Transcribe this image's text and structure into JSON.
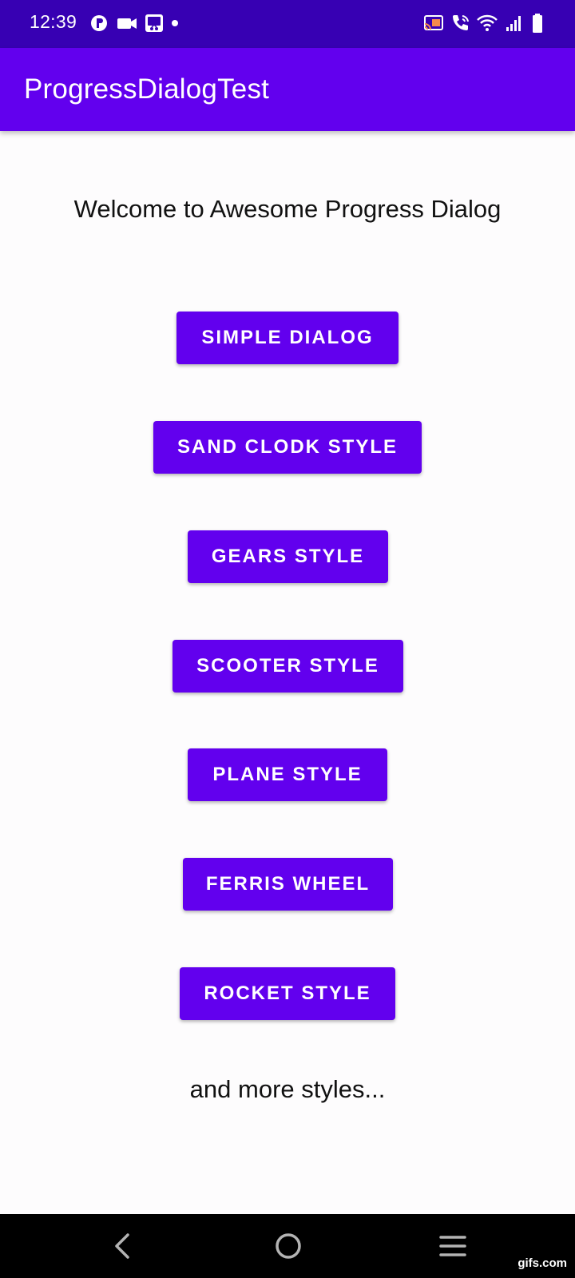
{
  "status_bar": {
    "time": "12:39",
    "left_icons": [
      "app-notification-icon",
      "video-camera-icon",
      "screen-record-icon",
      "dot-icon"
    ],
    "right_icons": [
      "cast-icon",
      "wifi-calling-icon",
      "wifi-icon",
      "cellular-signal-icon",
      "battery-icon"
    ],
    "color": "#3700b3"
  },
  "app_bar": {
    "title": "ProgressDialogTest",
    "color": "#6200ee"
  },
  "main": {
    "welcome_text": "Welcome to Awesome Progress Dialog",
    "buttons": [
      {
        "label": "SIMPLE DIALOG"
      },
      {
        "label": "SAND CLODK STYLE"
      },
      {
        "label": "GEARS STYLE"
      },
      {
        "label": "SCOOTER STYLE"
      },
      {
        "label": "PLANE STYLE"
      },
      {
        "label": "FERRIS WHEEL"
      },
      {
        "label": "ROCKET STYLE"
      }
    ],
    "more_text": "and more styles...",
    "button_color": "#6200ee"
  },
  "nav_bar": {
    "icons": [
      "back-icon",
      "home-icon",
      "recent-apps-icon"
    ]
  },
  "watermark": "gifs.com"
}
